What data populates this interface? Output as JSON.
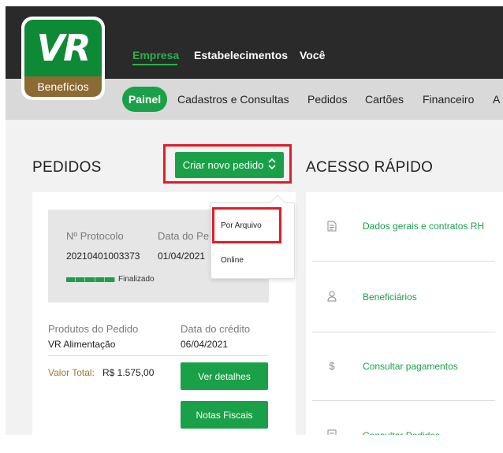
{
  "brand": {
    "logo_top": "VR",
    "logo_bottom": "Benefícios"
  },
  "top_nav": [
    {
      "label": "Empresa",
      "active": true
    },
    {
      "label": "Estabelecimentos",
      "active": false
    },
    {
      "label": "Você",
      "active": false
    }
  ],
  "tabs": [
    {
      "label": "Painel",
      "active": true
    },
    {
      "label": "Cadastros e Consultas"
    },
    {
      "label": "Pedidos"
    },
    {
      "label": "Cartões"
    },
    {
      "label": "Financeiro"
    },
    {
      "label": "A"
    }
  ],
  "orders": {
    "title": "PEDIDOS",
    "create_button": "Criar novo pedido",
    "dropdown": {
      "items": [
        "Por Arquivo",
        "Online"
      ]
    },
    "card": {
      "protocol_label": "Nº Protocolo",
      "protocol_value": "20210401003373",
      "date_label": "Data do Pe",
      "date_value": "01/04/2021",
      "status_label": "Finalizado",
      "products_label": "Produtos do Pedido",
      "products_value": "VR Alimentação",
      "credit_date_label": "Data do crédito",
      "credit_date_value": "06/04/2021",
      "total_label": "Valor Total:",
      "total_value": "R$ 1.575,00",
      "details_button": "Ver detalhes",
      "invoices_button": "Notas Fiscais"
    }
  },
  "quick_access": {
    "title": "ACESSO RÁPIDO",
    "items": [
      {
        "label": "Dados gerais e contratos RH",
        "icon": "document-icon"
      },
      {
        "label": "Beneficiários",
        "icon": "user-icon"
      },
      {
        "label": "Consultar pagamentos",
        "icon": "dollar-icon"
      },
      {
        "label": "Consultar Pedidos",
        "icon": "list-icon"
      }
    ]
  },
  "colors": {
    "accent_green": "#1aa048",
    "highlight_red": "#e41b2a",
    "header_dark": "#2a2a2a",
    "gold": "#a07a2c"
  }
}
